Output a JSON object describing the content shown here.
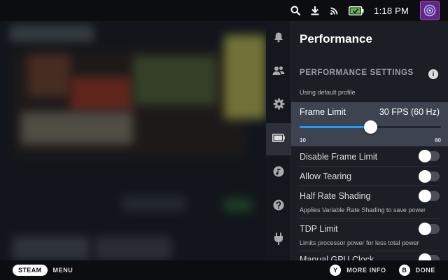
{
  "status_bar": {
    "icons": [
      "search-icon",
      "download-icon",
      "wifi-icon",
      "battery-icon"
    ],
    "time": "1:18 PM"
  },
  "rail": {
    "items": [
      {
        "icon": "bell-icon",
        "active": false
      },
      {
        "icon": "friends-icon",
        "active": false
      },
      {
        "icon": "gear-icon",
        "active": false
      },
      {
        "icon": "battery-performance-icon",
        "active": true
      },
      {
        "icon": "music-icon",
        "active": false
      },
      {
        "icon": "help-icon",
        "active": false
      },
      {
        "icon": "plug-icon",
        "active": false
      }
    ]
  },
  "panel": {
    "title": "Performance",
    "section_heading": "PERFORMANCE SETTINGS",
    "info_glyph": "i",
    "profile_note": "Using default profile",
    "frame_limit": {
      "label": "Frame Limit",
      "value_text": "30 FPS (60 Hz)",
      "min_label": "10",
      "max_label": "60",
      "fraction": 0.5
    },
    "toggles": [
      {
        "label": "Disable Frame Limit",
        "description": "",
        "on": false
      },
      {
        "label": "Allow Tearing",
        "description": "",
        "on": false
      },
      {
        "label": "Half Rate Shading",
        "description": "Applies Variable Rate Shading to save power",
        "on": false
      },
      {
        "label": "TDP Limit",
        "description": "Limits processor power for less total power",
        "on": false
      },
      {
        "label": "Manual GPU Clock",
        "description": "",
        "on": false
      }
    ]
  },
  "bottom_bar": {
    "steam_label": "STEAM",
    "menu_label": "MENU",
    "y_glyph": "Y",
    "more_info_label": "MORE INFO",
    "b_glyph": "B",
    "done_label": "DONE"
  },
  "colors": {
    "accent": "#1a9fff",
    "panel_bg": "#1b1e24",
    "highlight_row": "#3d4450",
    "battery_green": "#59bf40"
  }
}
